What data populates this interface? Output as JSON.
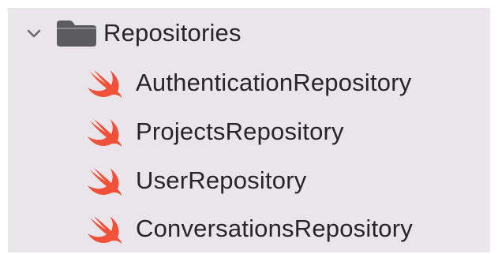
{
  "navigator": {
    "folder": {
      "name": "Repositories",
      "expanded": true,
      "icon": "folder-icon",
      "disclosure_icon": "chevron-down-icon"
    },
    "files": [
      {
        "name": "AuthenticationRepository",
        "icon": "swift-file-icon"
      },
      {
        "name": "ProjectsRepository",
        "icon": "swift-file-icon"
      },
      {
        "name": "UserRepository",
        "icon": "swift-file-icon"
      },
      {
        "name": "ConversationsRepository",
        "icon": "swift-file-icon"
      }
    ]
  },
  "colors": {
    "background": "#e9e5ea",
    "text": "#262626",
    "folder": "#5c5c5e",
    "swift_orange": "#f05138"
  }
}
